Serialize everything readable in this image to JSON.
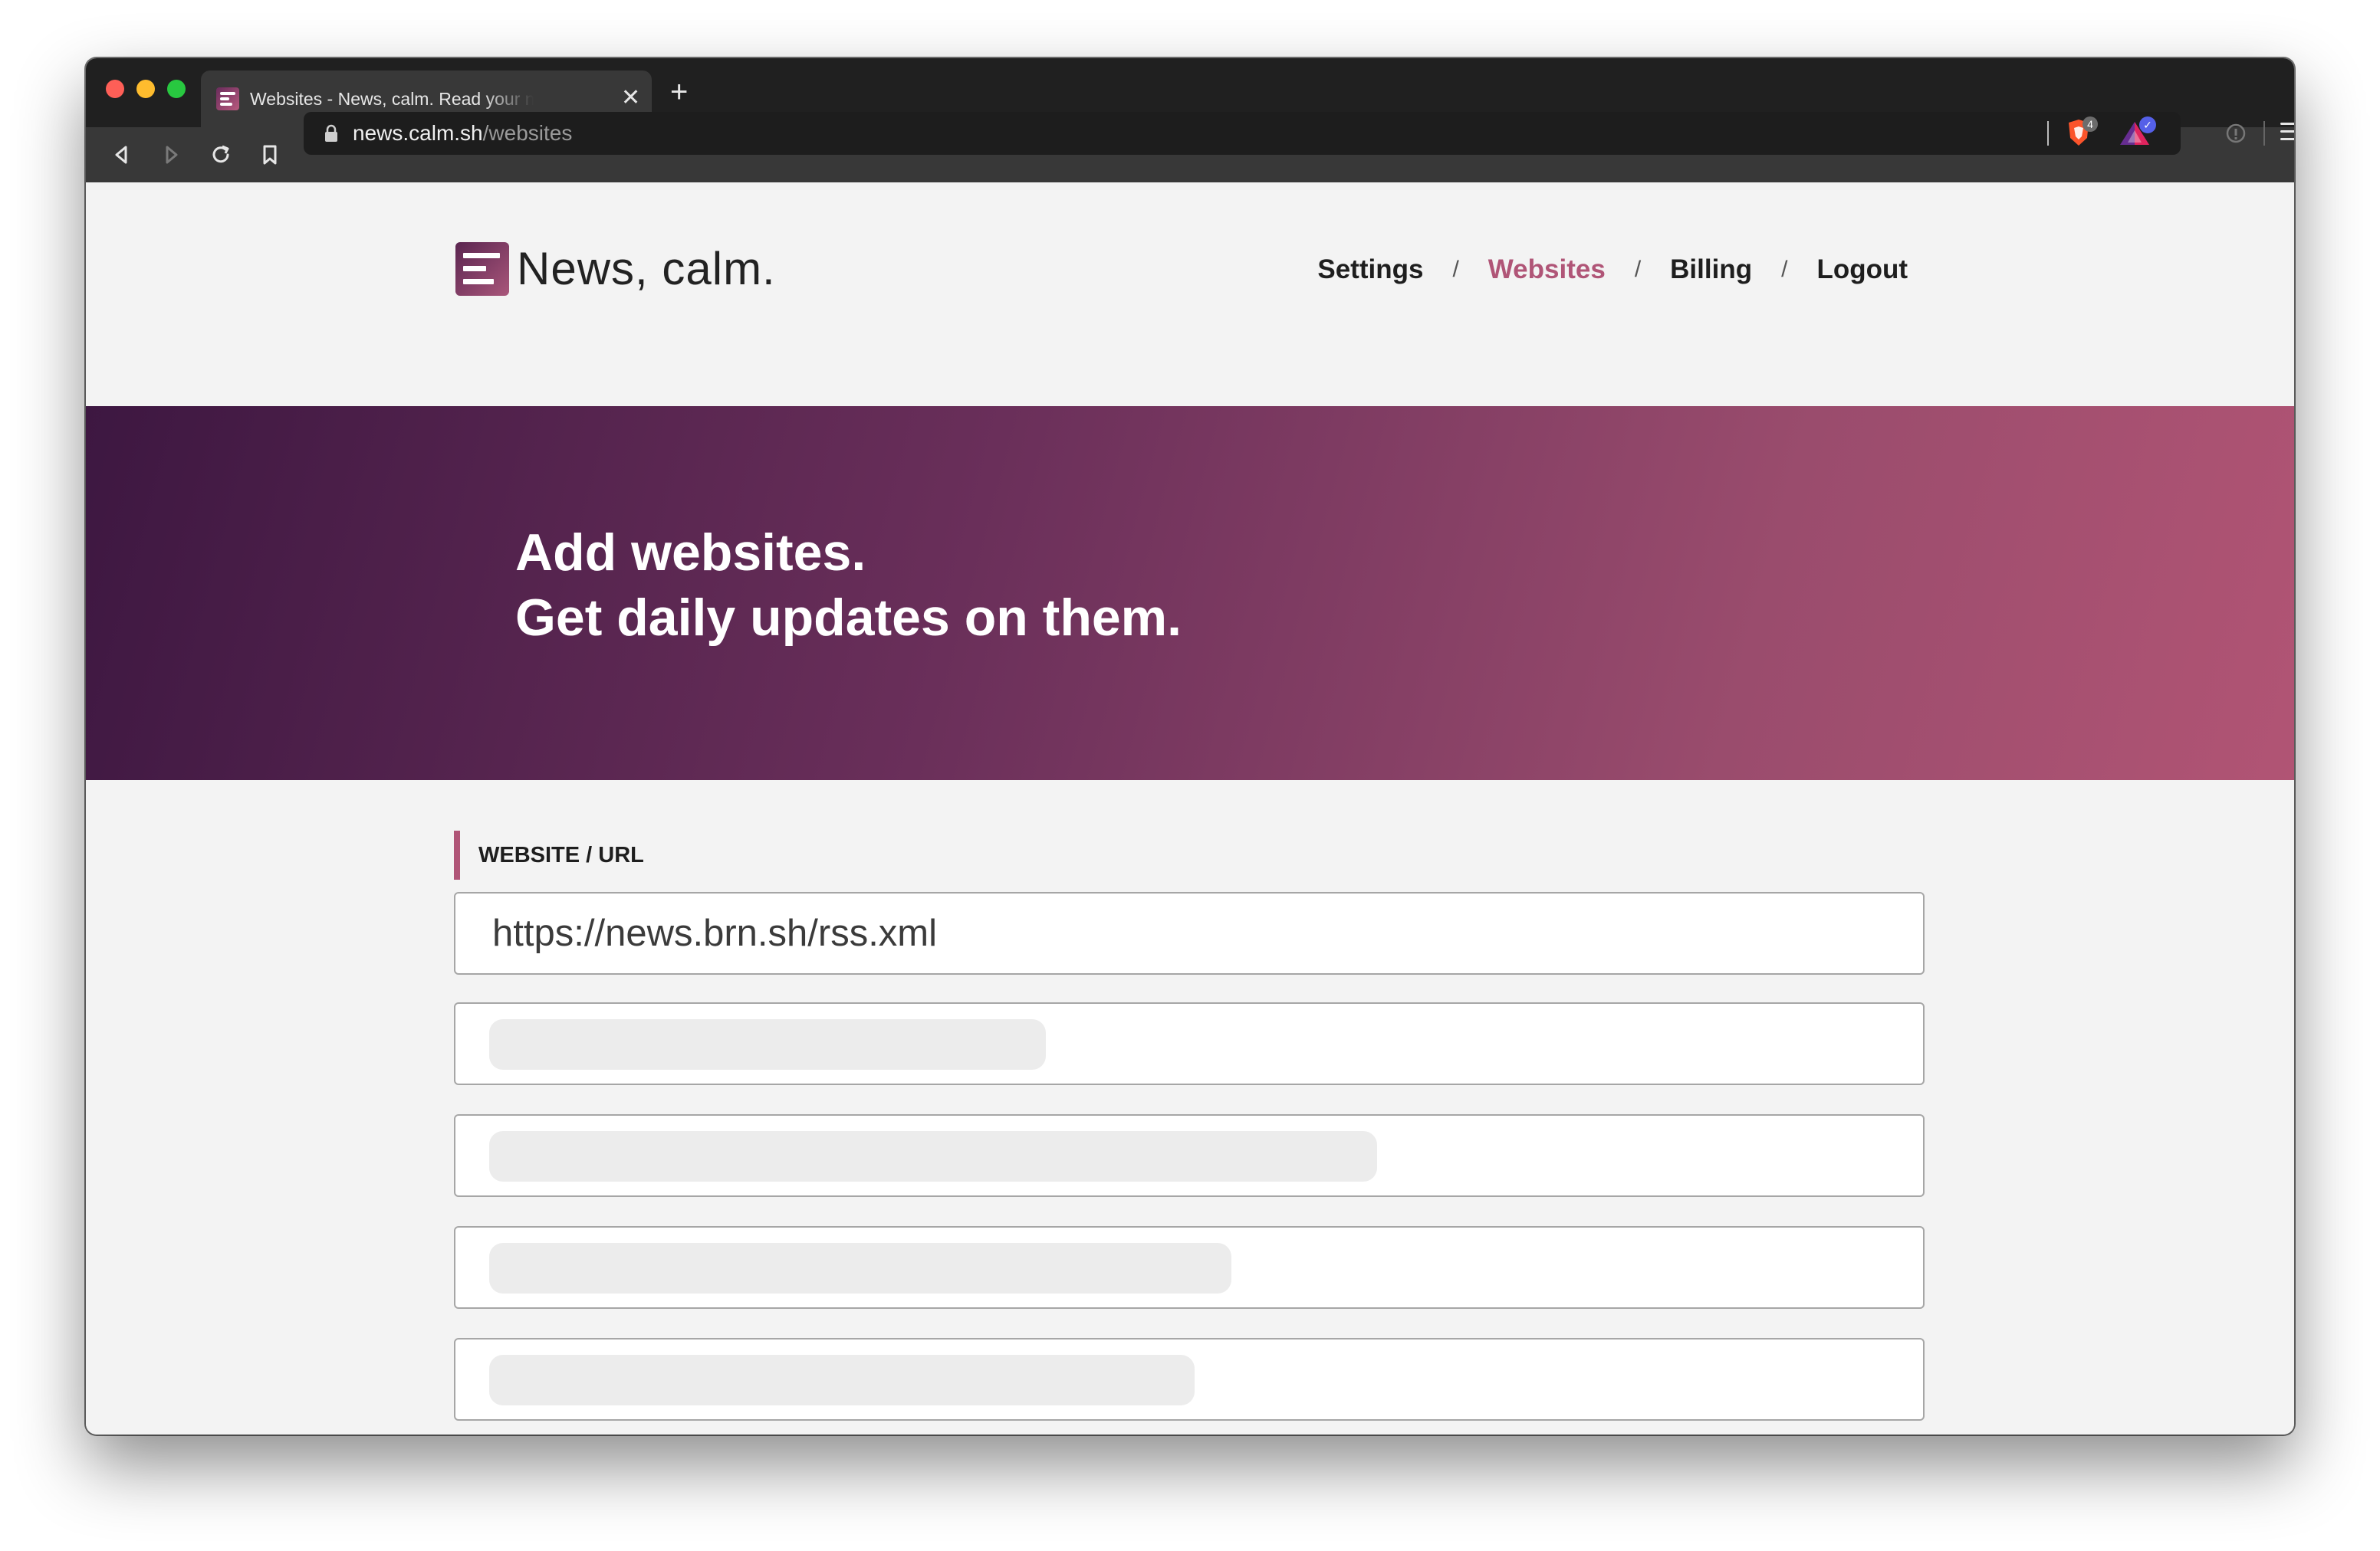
{
  "browser": {
    "tab_title": "Websites - News, calm. Read your news calmly",
    "tab_close_glyph": "✕",
    "new_tab_glyph": "+",
    "url_host": "news.calm.sh",
    "url_path": "/websites",
    "brave_shield_count": "4",
    "rewards_check_glyph": "✓"
  },
  "site": {
    "brand": "News, calm.",
    "nav": [
      {
        "label": "Settings",
        "active": false
      },
      {
        "label": "Websites",
        "active": true
      },
      {
        "label": "Billing",
        "active": false
      },
      {
        "label": "Logout",
        "active": false
      }
    ],
    "nav_separator": "/",
    "hero_line1": "Add websites.",
    "hero_line2": "Get daily updates on them.",
    "section_label": "WEBSITE / URL",
    "url_input_value": "https://news.brn.sh/rss.xml",
    "placeholder_rows": [
      {
        "state": "loading"
      },
      {
        "state": "loading"
      },
      {
        "state": "loading"
      },
      {
        "state": "loading"
      },
      {
        "state": "loading"
      }
    ]
  },
  "colors": {
    "accent": "#b05577",
    "hero_start": "#3d1741",
    "hero_end": "#b15474",
    "chrome_dark": "#202020"
  }
}
